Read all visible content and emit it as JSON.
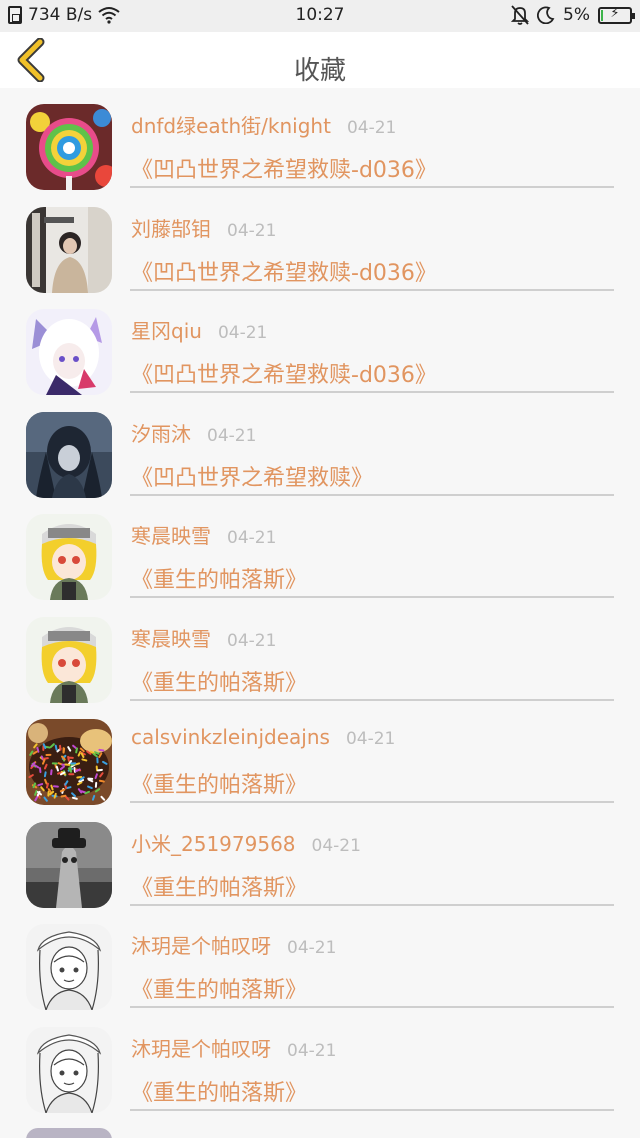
{
  "status_bar": {
    "net_speed": "734 B/s",
    "time": "10:27",
    "battery_percent": "5%",
    "battery_level": 0.05,
    "icons": [
      "sim-icon",
      "wifi-icon",
      "mute-icon",
      "moon-icon",
      "battery-icon"
    ]
  },
  "header": {
    "title": "收藏",
    "back_icon": "chevron-left-icon",
    "accent_color": "#f0c12a"
  },
  "colors": {
    "accent": "#e19560",
    "date": "#bdbdbd",
    "background": "#f7f7f7"
  },
  "items": [
    {
      "author": "dnfd绿eath街/knight",
      "date": "04-21",
      "book": "《凹凸世界之希望救赎-d036》",
      "avatar": "lollipop-avatar"
    },
    {
      "author": "刘藤郜钼",
      "date": "04-21",
      "book": "《凹凸世界之希望救赎-d036》",
      "avatar": "girl-photo-avatar"
    },
    {
      "author": "星冈qiu",
      "date": "04-21",
      "book": "《凹凸世界之希望救赎-d036》",
      "avatar": "anime-white-hair-avatar"
    },
    {
      "author": "汐雨沐",
      "date": "04-21",
      "book": "《凹凸世界之希望救赎》",
      "avatar": "anime-dark-avatar"
    },
    {
      "author": "寒晨映雪",
      "date": "04-21",
      "book": "《重生的帕落斯》",
      "avatar": "anime-blonde-avatar"
    },
    {
      "author": "寒晨映雪",
      "date": "04-21",
      "book": "《重生的帕落斯》",
      "avatar": "anime-blonde-avatar"
    },
    {
      "author": "calsvinkzleinjdeajns",
      "date": "04-21",
      "book": "《重生的帕落斯》",
      "avatar": "sprinkles-avatar"
    },
    {
      "author": "小米_251979568",
      "date": "04-21",
      "book": "《重生的帕落斯》",
      "avatar": "patrick-avatar"
    },
    {
      "author": "沐玥是个帕叹呀",
      "date": "04-21",
      "book": "《重生的帕落斯》",
      "avatar": "sketch-maid-avatar"
    },
    {
      "author": "沐玥是个帕叹呀",
      "date": "04-21",
      "book": "《重生的帕落斯》",
      "avatar": "sketch-maid-avatar"
    }
  ]
}
